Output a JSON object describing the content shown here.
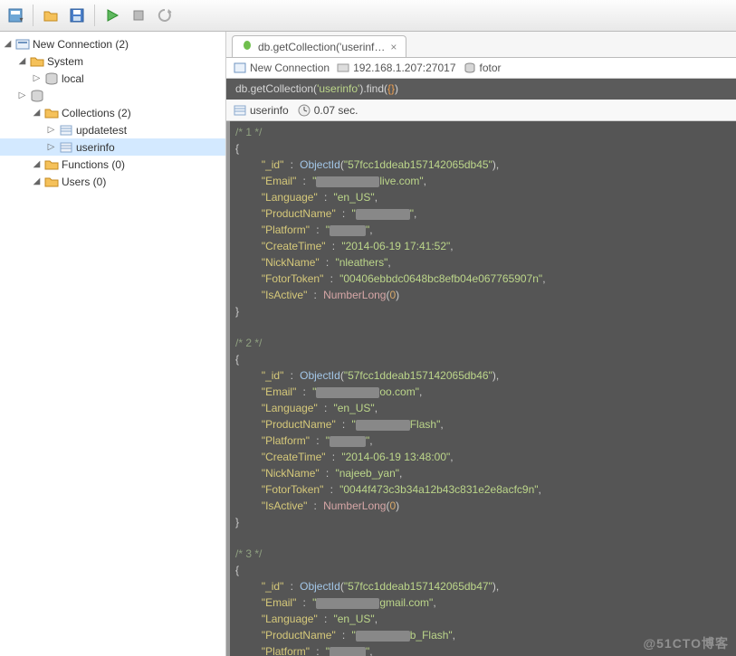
{
  "toolbar": {
    "buttons": [
      "server-icon",
      "open-icon",
      "save-icon",
      "run-icon",
      "stop-icon",
      "refresh-icon"
    ]
  },
  "tree": {
    "root_label": "New Connection (2)",
    "system_label": "System",
    "local_label": "local",
    "hidden_node": "",
    "collections_label": "Collections (2)",
    "coll1": "updatetest",
    "coll2": "userinfo",
    "functions_label": "Functions (0)",
    "users_label": "Users (0)"
  },
  "tab": {
    "title": "db.getCollection('userinf…",
    "close": "×"
  },
  "crumb": {
    "conn": "New Connection",
    "host": "192.168.1.207:27017",
    "db": "fotor"
  },
  "query": {
    "prefix": "db.getCollection(",
    "arg": "'userinfo'",
    "suffix": ").find(",
    "obj": "{}",
    "end": ")"
  },
  "status": {
    "coll": "userinfo",
    "time": "0.07 sec."
  },
  "docs": [
    {
      "idx": "/* 1 */",
      "_id": "57fcc1ddeab157142065db45",
      "Email_suffix": "live.com",
      "Language": "en_US",
      "ProductName_suffix": "",
      "Platform": "",
      "CreateTime": "2014-06-19 17:41:52",
      "NickName": "nleathers",
      "FotorToken": "00406ebbdc0648bc8efb04e067765907n",
      "IsActive": 0
    },
    {
      "idx": "/* 2 */",
      "_id": "57fcc1ddeab157142065db46",
      "Email_suffix": "oo.com",
      "Language": "en_US",
      "ProductName_suffix": "Flash",
      "Platform": "",
      "CreateTime": "2014-06-19 13:48:00",
      "NickName": "najeeb_yan",
      "FotorToken": "0044f473c3b34a12b43c831e2e8acfc9n",
      "IsActive": 0
    },
    {
      "idx": "/* 3 */",
      "_id": "57fcc1ddeab157142065db47",
      "Email_suffix": "gmail.com",
      "Language": "en_US",
      "ProductName_suffix": "b_Flash",
      "Platform": ""
    }
  ],
  "watermark": "@51CTO博客"
}
